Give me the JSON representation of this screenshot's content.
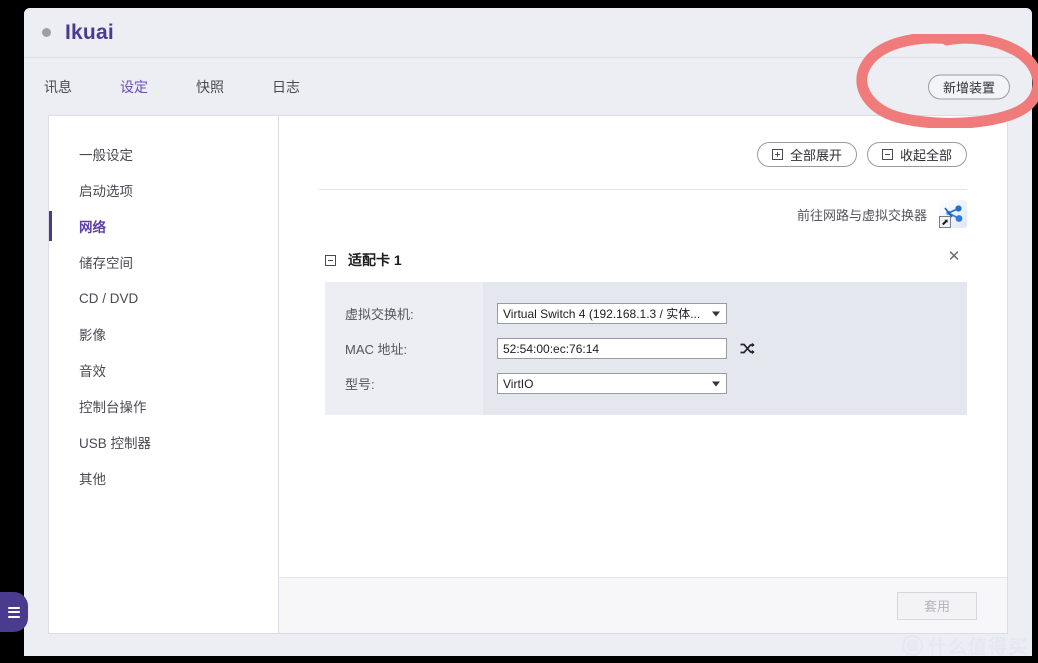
{
  "window": {
    "title": "Ikuai",
    "status_dot": "grey-status-dot"
  },
  "tabs": [
    {
      "label": "讯息",
      "active": false
    },
    {
      "label": "设定",
      "active": true
    },
    {
      "label": "快照",
      "active": false
    },
    {
      "label": "日志",
      "active": false
    }
  ],
  "toolbar": {
    "add_device_label": "新增装置"
  },
  "sidebar": {
    "items": [
      {
        "label": "一般设定",
        "active": false
      },
      {
        "label": "启动选项",
        "active": false
      },
      {
        "label": "网络",
        "active": true
      },
      {
        "label": "储存空间",
        "active": false
      },
      {
        "label": "CD / DVD",
        "active": false
      },
      {
        "label": "影像",
        "active": false
      },
      {
        "label": "音效",
        "active": false
      },
      {
        "label": "控制台操作",
        "active": false
      },
      {
        "label": "USB 控制器",
        "active": false
      },
      {
        "label": "其他",
        "active": false
      }
    ]
  },
  "content": {
    "expand_all_label": "全部展开",
    "collapse_all_label": "收起全部",
    "goto_link_label": "前往网路与虚拟交换器",
    "goto_icon": "virtual-switch-shortcut-icon",
    "adapter": {
      "title": "适配卡 1",
      "collapse_glyph": "minus-box-icon",
      "close_glyph": "close-icon",
      "fields": [
        {
          "label": "虚拟交换机:",
          "type": "select",
          "value": "Virtual Switch 4 (192.168.1.3 / 实体..."
        },
        {
          "label": "MAC 地址:",
          "type": "text",
          "value": "52:54:00:ec:76:14",
          "action_icon": "shuffle-icon"
        },
        {
          "label": "型号:",
          "type": "select",
          "value": "VirtIO"
        }
      ]
    }
  },
  "footer": {
    "apply_label": "套用",
    "apply_disabled": true
  },
  "annotation": {
    "type": "hand-drawn-ellipse",
    "color": "#f07b7b",
    "target": "新增装置"
  },
  "watermark": {
    "badge": "值",
    "text": "什么值得买"
  },
  "side_handle": {
    "icon": "hamburger-menu-icon",
    "color": "#4b3b8f"
  }
}
